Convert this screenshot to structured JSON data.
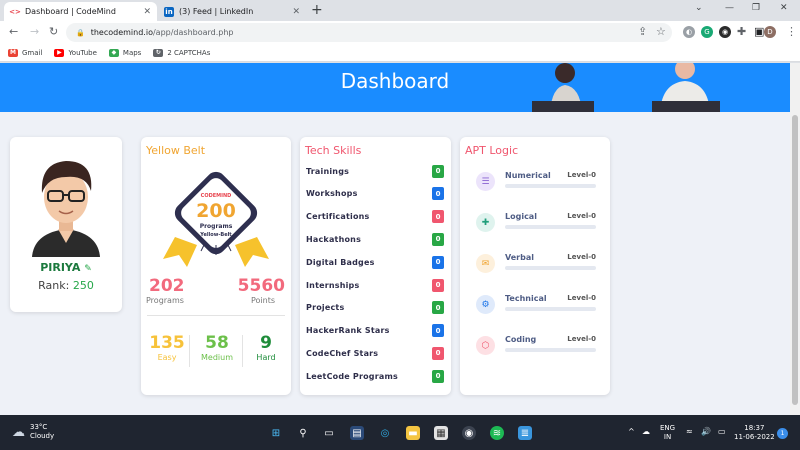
{
  "browser": {
    "tabs": [
      {
        "title": "Dashboard | CodeMind",
        "icon": "codemind-icon",
        "active": true
      },
      {
        "title": "(3) Feed | LinkedIn",
        "icon": "linkedin-icon",
        "active": false
      }
    ],
    "url_host": "thecodemind.io",
    "url_path": "/app/dashboard.php",
    "profile_initial": "D",
    "bookmarks": [
      {
        "label": "Gmail",
        "icon": "gmail-icon",
        "color": "#ea4335"
      },
      {
        "label": "YouTube",
        "icon": "youtube-icon",
        "color": "#ff0000"
      },
      {
        "label": "Maps",
        "icon": "maps-icon",
        "color": "#34a853"
      },
      {
        "label": "2 CAPTCHAs",
        "icon": "captcha-icon",
        "color": "#5f6368"
      }
    ]
  },
  "page": {
    "banner_title": "Dashboard",
    "profile": {
      "name": "PIRIYA",
      "rank_label": "Rank:",
      "rank_value": "250"
    },
    "belt": {
      "title": "Yellow Belt",
      "badge_brand": "CODEMIND",
      "badge_number": "200",
      "badge_label": "Programs",
      "badge_belt": "Yellow-Belt",
      "programs_value": "202",
      "programs_label": "Programs",
      "points_value": "5560",
      "points_label": "Points",
      "easy_value": "135",
      "easy_label": "Easy",
      "medium_value": "58",
      "medium_label": "Medium",
      "hard_value": "9",
      "hard_label": "Hard",
      "colors": {
        "easy": "#f7c23a",
        "medium": "#6cc04a",
        "hard": "#1e8c3a"
      }
    },
    "tech_skills": {
      "title": "Tech Skills",
      "items": [
        {
          "label": "Trainings",
          "count": "0",
          "color": "#28a745"
        },
        {
          "label": "Workshops",
          "count": "0",
          "color": "#1a73e8"
        },
        {
          "label": "Certifications",
          "count": "0",
          "color": "#f0566e"
        },
        {
          "label": "Hackathons",
          "count": "0",
          "color": "#28a745"
        },
        {
          "label": "Digital Badges",
          "count": "0",
          "color": "#1a73e8"
        },
        {
          "label": "Internships",
          "count": "0",
          "color": "#f0566e"
        },
        {
          "label": "Projects",
          "count": "0",
          "color": "#28a745"
        },
        {
          "label": "HackerRank Stars",
          "count": "0",
          "color": "#1a73e8"
        },
        {
          "label": "CodeChef Stars",
          "count": "0",
          "color": "#f0566e"
        },
        {
          "label": "LeetCode Programs",
          "count": "0",
          "color": "#28a745"
        }
      ]
    },
    "apt_logic": {
      "title": "APT Logic",
      "items": [
        {
          "label": "Numerical",
          "level": "Level-0",
          "icon": "list-icon",
          "bg": "#ece4fb",
          "fg": "#8a63d2",
          "progress": 0
        },
        {
          "label": "Logical",
          "level": "Level-0",
          "icon": "puzzle-icon",
          "bg": "#dff3ee",
          "fg": "#1f9e7a",
          "progress": 0
        },
        {
          "label": "Verbal",
          "level": "Level-0",
          "icon": "chat-icon",
          "bg": "#fdf0dc",
          "fg": "#f0a531",
          "progress": 0
        },
        {
          "label": "Technical",
          "level": "Level-0",
          "icon": "gears-icon",
          "bg": "#dfeafb",
          "fg": "#1a73e8",
          "progress": 0
        },
        {
          "label": "Coding",
          "level": "Level-0",
          "icon": "code-icon",
          "bg": "#fde0e4",
          "fg": "#f0566e",
          "progress": 0
        }
      ]
    }
  },
  "taskbar": {
    "weather_temp": "33°C",
    "weather_desc": "Cloudy",
    "lang_top": "ENG",
    "lang_bottom": "IN",
    "time": "18:37",
    "date": "11-06-2022",
    "notifications": "1"
  }
}
